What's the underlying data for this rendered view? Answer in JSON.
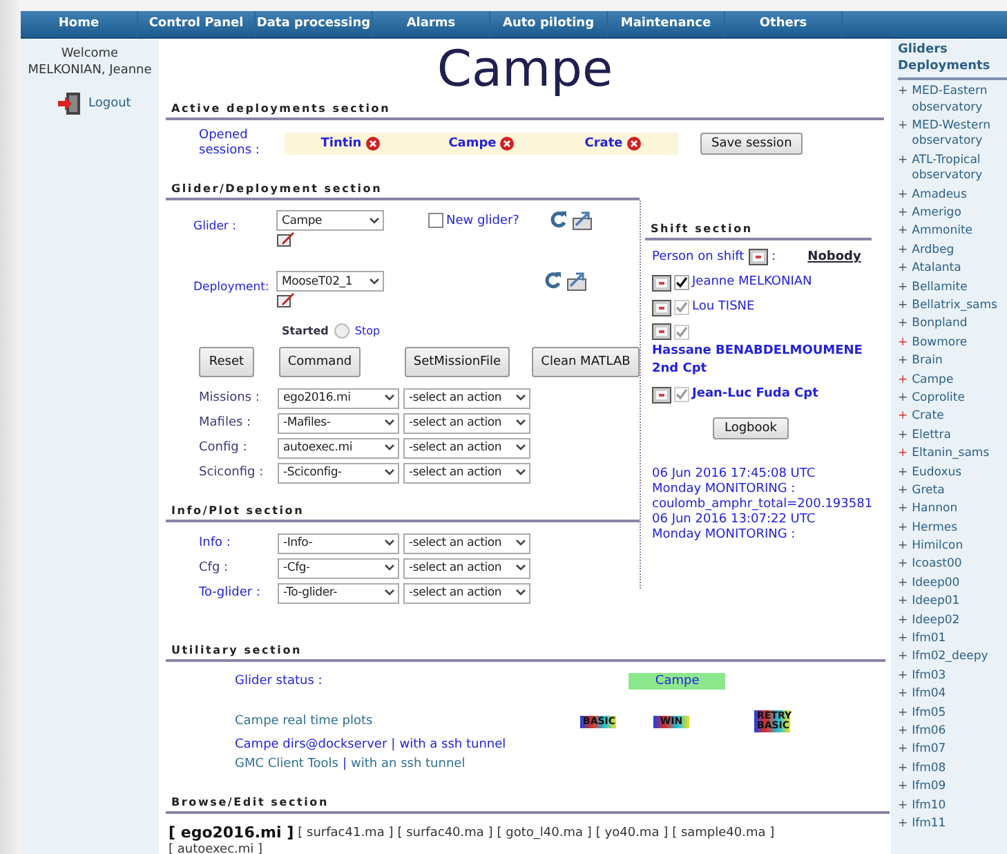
{
  "nav": [
    {
      "label": "Home",
      "selected": false
    },
    {
      "label": "Control Panel",
      "selected": false
    },
    {
      "label": "Data processing",
      "selected": false
    },
    {
      "label": "Alarms",
      "selected": false
    },
    {
      "label": "Auto piloting",
      "selected": false
    },
    {
      "label": "Maintenance",
      "selected": false
    },
    {
      "label": "Others",
      "selected": false
    }
  ],
  "user": {
    "welcome": "Welcome",
    "name": "MELKONIAN, Jeanne",
    "logout": "Logout"
  },
  "title": "Campe",
  "active_section": {
    "heading": "Active deployments section",
    "label": "Opened sessions :",
    "sessions": [
      "Tintin",
      "Campe",
      "Crate"
    ],
    "save": "Save session"
  },
  "glider_section": {
    "heading": "Glider/Deployment section",
    "glider": {
      "label": "Glider :",
      "value": "Campe",
      "new_glider": "New glider?",
      "new_checked": false
    },
    "deployment": {
      "label": "Deployment:",
      "value": "MooseT02_1",
      "started": "Started",
      "stop": "Stop",
      "stop_selected": false
    },
    "buttons": [
      "Reset",
      "Command",
      "SetMissionFile",
      "Clean MATLAB"
    ],
    "rows": [
      {
        "label": "Missions :",
        "value": "ego2016.mi",
        "action": "-select an action",
        "link": false
      },
      {
        "label": "Mafiles :",
        "value": "-Mafiles-",
        "action": "-select an action",
        "link": false
      },
      {
        "label": "Config :",
        "value": "autoexec.mi",
        "action": "-select an action",
        "link": false
      },
      {
        "label": "Sciconfig :",
        "value": "-Sciconfig-",
        "action": "-select an action",
        "link": false
      }
    ]
  },
  "info_section": {
    "heading": "Info/Plot section",
    "rows": [
      {
        "label": "Info :",
        "value": "-Info-",
        "action": "-select an action",
        "link": true
      },
      {
        "label": "Cfg :",
        "value": "-Cfg-",
        "action": "-select an action",
        "link": false
      },
      {
        "label": "To-glider :",
        "value": "-To-glider-",
        "action": "-select an action",
        "link": true
      }
    ]
  },
  "shift_section": {
    "heading": "Shift section",
    "person_label": "Person on shift",
    "colon": ":",
    "on_shift": "Nobody",
    "people": [
      {
        "name": "Jeanne MELKONIAN",
        "checked": true,
        "disabled": false,
        "emphasized": false
      },
      {
        "name": "Lou TISNE",
        "checked": true,
        "disabled": true,
        "emphasized": false
      },
      {
        "name": "Hassane BENABDELMOUMENE 2nd Cpt",
        "checked": true,
        "disabled": true,
        "emphasized": true
      },
      {
        "name": "Jean-Luc Fuda Cpt",
        "checked": true,
        "disabled": true,
        "emphasized": true
      }
    ],
    "logbook": "Logbook",
    "log": [
      "06 Jun 2016 17:45:08 UTC",
      "Monday MONITORING :",
      "coulomb_amphr_total=200.193581",
      "06 Jun 2016 13:07:22 UTC",
      "Monday MONITORING :"
    ]
  },
  "utility_section": {
    "heading": "Utilitary section",
    "status_label": "Glider status :",
    "status": "Campe",
    "plots_label": "Campe real time plots",
    "plot_buttons": [
      "BASIC",
      "WIN",
      "RETRY BASIC"
    ],
    "links": [
      {
        "text": "Campe dirs@dockserver",
        "sep": "|",
        "alt": "with a ssh tunnel",
        "strong": true
      },
      {
        "text": "GMC Client Tools",
        "sep": "|",
        "alt": "with an ssh tunnel",
        "strong": false
      }
    ]
  },
  "browse_section": {
    "heading": "Browse/Edit section",
    "files": [
      {
        "label": "[ ego2016.mi ]",
        "selected": true
      },
      {
        "label": "[ surfac41.ma ]",
        "selected": false
      },
      {
        "label": "[ surfac40.ma ]",
        "selected": false
      },
      {
        "label": "[ goto_l40.ma ]",
        "selected": false
      },
      {
        "label": "[ yo40.ma ]",
        "selected": false
      },
      {
        "label": "[ sample40.ma ]",
        "selected": false
      },
      {
        "label": "[ autoexec.mi ]",
        "selected": false
      }
    ]
  },
  "deployments": {
    "heading": "Gliders Deployments",
    "items": [
      {
        "marker": "+",
        "label": "MED-Eastern observatory",
        "active": false
      },
      {
        "marker": "+",
        "label": "MED-Western observatory",
        "active": false
      },
      {
        "marker": "+",
        "label": "ATL-Tropical observatory",
        "active": false
      },
      {
        "marker": "+",
        "label": "Amadeus",
        "active": false
      },
      {
        "marker": "+",
        "label": "Amerigo",
        "active": false
      },
      {
        "marker": "+",
        "label": "Ammonite",
        "active": false
      },
      {
        "marker": "+",
        "label": "Ardbeg",
        "active": false
      },
      {
        "marker": "+",
        "label": "Atalanta",
        "active": false
      },
      {
        "marker": "+",
        "label": "Bellamite",
        "active": false
      },
      {
        "marker": "+",
        "label": "Bellatrix_sams",
        "active": false
      },
      {
        "marker": "+",
        "label": "Bonpland",
        "active": false
      },
      {
        "marker": "+",
        "label": "Bowmore",
        "active": true
      },
      {
        "marker": "+",
        "label": "Brain",
        "active": false
      },
      {
        "marker": "+",
        "label": "Campe",
        "active": true
      },
      {
        "marker": "+",
        "label": "Coprolite",
        "active": false
      },
      {
        "marker": "+",
        "label": "Crate",
        "active": true
      },
      {
        "marker": "+",
        "label": "Elettra",
        "active": false
      },
      {
        "marker": "+",
        "label": "Eltanin_sams",
        "active": true
      },
      {
        "marker": "+",
        "label": "Eudoxus",
        "active": false
      },
      {
        "marker": "+",
        "label": "Greta",
        "active": false
      },
      {
        "marker": "+",
        "label": "Hannon",
        "active": false
      },
      {
        "marker": "+",
        "label": "Hermes",
        "active": false
      },
      {
        "marker": "+",
        "label": "Himilcon",
        "active": false
      },
      {
        "marker": "+",
        "label": "Icoast00",
        "active": false
      },
      {
        "marker": "+",
        "label": "Ideep00",
        "active": false
      },
      {
        "marker": "+",
        "label": "Ideep01",
        "active": false
      },
      {
        "marker": "+",
        "label": "Ideep02",
        "active": false
      },
      {
        "marker": "+",
        "label": "Ifm01",
        "active": false
      },
      {
        "marker": "+",
        "label": "Ifm02_deepy",
        "active": false
      },
      {
        "marker": "+",
        "label": "Ifm03",
        "active": false
      },
      {
        "marker": "+",
        "label": "Ifm04",
        "active": false
      },
      {
        "marker": "+",
        "label": "Ifm05",
        "active": false
      },
      {
        "marker": "+",
        "label": "Ifm06",
        "active": false
      },
      {
        "marker": "+",
        "label": "Ifm07",
        "active": false
      },
      {
        "marker": "+",
        "label": "Ifm08",
        "active": false
      },
      {
        "marker": "+",
        "label": "Ifm09",
        "active": false
      },
      {
        "marker": "+",
        "label": "Ifm10",
        "active": false
      },
      {
        "marker": "+",
        "label": "Ifm11",
        "active": false
      }
    ]
  }
}
